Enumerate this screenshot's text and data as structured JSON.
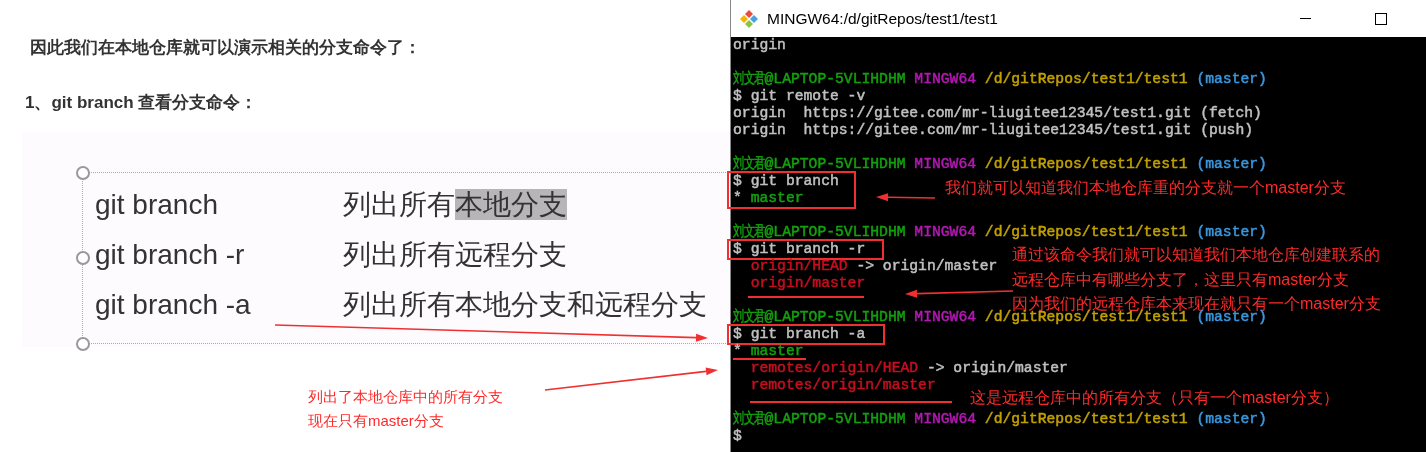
{
  "article": {
    "heading": "因此我们在本地仓库就可以演示相关的分支命令了：",
    "subheading": "1、git branch  查看分支命令："
  },
  "slide": {
    "rows": [
      {
        "command": "git branch",
        "description": [
          {
            "text": "列出所有",
            "selected": false
          },
          {
            "text": "本地分支",
            "selected": true
          }
        ]
      },
      {
        "command": "git branch -r",
        "description": [
          {
            "text": "列出所有远程分支",
            "selected": false
          }
        ]
      },
      {
        "command": "git branch -a",
        "description": [
          {
            "text": "列出所有本地分支和远程分支",
            "selected": false
          }
        ]
      }
    ]
  },
  "terminal": {
    "title": "MINGW64:/d/gitRepos/test1/test1",
    "lines": [
      {
        "kind": "text",
        "segments": [
          {
            "text": "origin",
            "color": "#c0c0c0"
          }
        ]
      },
      {
        "kind": "blank"
      },
      {
        "kind": "text",
        "segments": [
          {
            "text": "刘文君@LAPTOP-5VLIHDHM",
            "color": "#13a10e"
          },
          {
            "text": " MINGW64",
            "color": "#b418b4"
          },
          {
            "text": " /d/gitRepos/test1/test1",
            "color": "#c1a100"
          },
          {
            "text": " (master)",
            "color": "#3a96dd"
          }
        ]
      },
      {
        "kind": "text",
        "segments": [
          {
            "text": "$ git remote -v",
            "color": "#c0c0c0"
          }
        ]
      },
      {
        "kind": "text",
        "segments": [
          {
            "text": "origin  https://gitee.com/mr-liugitee12345/test1.git (fetch)",
            "color": "#c0c0c0"
          }
        ]
      },
      {
        "kind": "text",
        "segments": [
          {
            "text": "origin  https://gitee.com/mr-liugitee12345/test1.git (push)",
            "color": "#c0c0c0"
          }
        ]
      },
      {
        "kind": "blank"
      },
      {
        "kind": "text",
        "segments": [
          {
            "text": "刘文君@LAPTOP-5VLIHDHM",
            "color": "#13a10e"
          },
          {
            "text": " MINGW64",
            "color": "#b418b4"
          },
          {
            "text": " /d/gitRepos/test1/test1",
            "color": "#c1a100"
          },
          {
            "text": " (master)",
            "color": "#3a96dd"
          }
        ]
      },
      {
        "kind": "text",
        "segments": [
          {
            "text": "$ git branch",
            "color": "#c0c0c0"
          }
        ]
      },
      {
        "kind": "text",
        "segments": [
          {
            "text": "* ",
            "color": "#c0c0c0"
          },
          {
            "text": "master",
            "color": "#13a10e"
          }
        ]
      },
      {
        "kind": "blank"
      },
      {
        "kind": "text",
        "segments": [
          {
            "text": "刘文君@LAPTOP-5VLIHDHM",
            "color": "#13a10e"
          },
          {
            "text": " MINGW64",
            "color": "#b418b4"
          },
          {
            "text": " /d/gitRepos/test1/test1",
            "color": "#c1a100"
          },
          {
            "text": " (master)",
            "color": "#3a96dd"
          }
        ]
      },
      {
        "kind": "text",
        "segments": [
          {
            "text": "$ git branch -r",
            "color": "#c0c0c0"
          }
        ]
      },
      {
        "kind": "text",
        "segments": [
          {
            "text": "  origin/HEAD",
            "color": "#c50f1f"
          },
          {
            "text": " -> origin/master",
            "color": "#c0c0c0"
          }
        ]
      },
      {
        "kind": "text",
        "segments": [
          {
            "text": "  origin/master",
            "color": "#c50f1f"
          }
        ]
      },
      {
        "kind": "blank"
      },
      {
        "kind": "text",
        "segments": [
          {
            "text": "刘文君@LAPTOP-5VLIHDHM",
            "color": "#13a10e"
          },
          {
            "text": " MINGW64",
            "color": "#b418b4"
          },
          {
            "text": " /d/gitRepos/test1/test1",
            "color": "#c1a100"
          },
          {
            "text": " (master)",
            "color": "#3a96dd"
          }
        ]
      },
      {
        "kind": "text",
        "segments": [
          {
            "text": "$ git branch -a",
            "color": "#c0c0c0"
          }
        ]
      },
      {
        "kind": "text",
        "segments": [
          {
            "text": "* ",
            "color": "#c0c0c0"
          },
          {
            "text": "master",
            "color": "#13a10e"
          }
        ]
      },
      {
        "kind": "text",
        "segments": [
          {
            "text": "  remotes/origin/HEAD",
            "color": "#c50f1f"
          },
          {
            "text": " -> origin/master",
            "color": "#c0c0c0"
          }
        ]
      },
      {
        "kind": "text",
        "segments": [
          {
            "text": "  remotes/origin/master",
            "color": "#c50f1f"
          }
        ]
      },
      {
        "kind": "blank"
      },
      {
        "kind": "text",
        "segments": [
          {
            "text": "刘文君@LAPTOP-5VLIHDHM",
            "color": "#13a10e"
          },
          {
            "text": " MINGW64",
            "color": "#b418b4"
          },
          {
            "text": " /d/gitRepos/test1/test1",
            "color": "#c1a100"
          },
          {
            "text": " (master)",
            "color": "#3a96dd"
          }
        ]
      },
      {
        "kind": "text",
        "segments": [
          {
            "text": "$",
            "color": "#c0c0c0"
          }
        ]
      }
    ]
  },
  "annotations": [
    {
      "lines": [
        "列出了本地仓库中的所有分支",
        "现在只有master分支"
      ]
    },
    {
      "lines": [
        "我们就可以知道我们本地仓库重的分支就一个master分支"
      ]
    },
    {
      "lines": [
        "通过该命令我们就可以知道我们本地仓库创建联系的",
        "远程仓库中有哪些分支了，这里只有master分支",
        "因为我们的远程仓库本来现在就只有一个master分支"
      ]
    },
    {
      "lines": [
        "这是远程仓库中的所有分支（只有一个master分支）"
      ]
    }
  ]
}
